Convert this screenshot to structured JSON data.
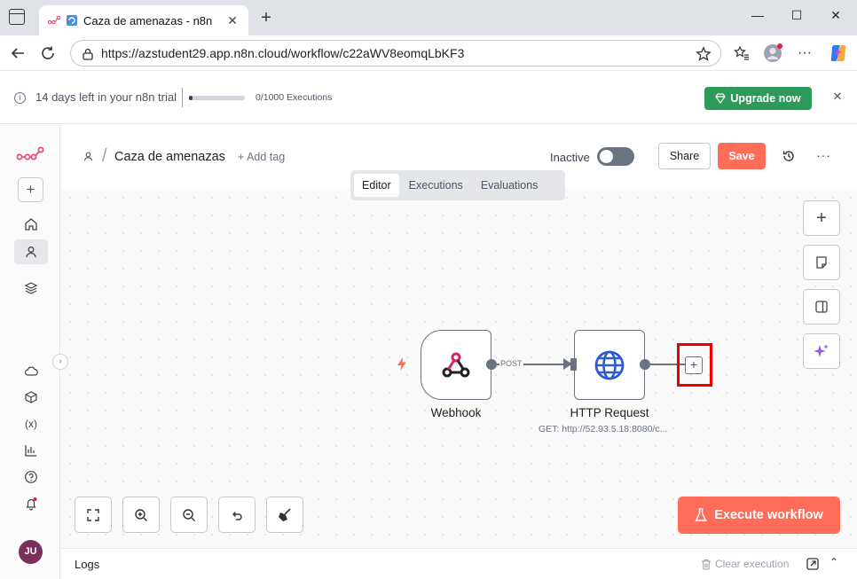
{
  "browser": {
    "tab_title": "Caza de amenazas - n8n",
    "tab_close": "✕",
    "new_tab": "+",
    "url": "https://azstudent29.app.n8n.cloud/workflow/c22aWV8eomqLbKF3",
    "window_minimize": "—",
    "window_maximize": "☐",
    "window_close": "✕"
  },
  "trial": {
    "days_left_text": "14 days left in your n8n trial",
    "executions_text": "0/1000 Executions",
    "progress_fraction": 0.0,
    "upgrade_label": "Upgrade now",
    "close": "✕"
  },
  "sidebar": {
    "add": "+",
    "avatar_initials": "JU",
    "collapse": "›"
  },
  "header": {
    "workflow_name": "Caza de amenazas",
    "add_tag": "+ Add tag",
    "status_label": "Inactive",
    "share_label": "Share",
    "save_label": "Save",
    "more": "···"
  },
  "view_tabs": [
    {
      "label": "Editor",
      "active": true
    },
    {
      "label": "Executions",
      "active": false
    },
    {
      "label": "Evaluations",
      "active": false
    }
  ],
  "nodes": {
    "webhook": {
      "label": "Webhook",
      "icon": "webhook-icon"
    },
    "edge_label": "POST",
    "http": {
      "label": "HTTP Request",
      "subtitle": "GET: http://52.93.5.18:8080/c...",
      "icon": "globe-icon"
    }
  },
  "canvas": {
    "add_node": "+",
    "execute_label": "Execute workflow"
  },
  "logs": {
    "title": "Logs",
    "clear_label": "Clear execution",
    "chevron": "⌃"
  },
  "colors": {
    "brand_orange": "#ff6d5a",
    "upgrade_green": "#2e9a5a",
    "highlight_red": "#ee0000",
    "node_border": "#6b7280"
  }
}
